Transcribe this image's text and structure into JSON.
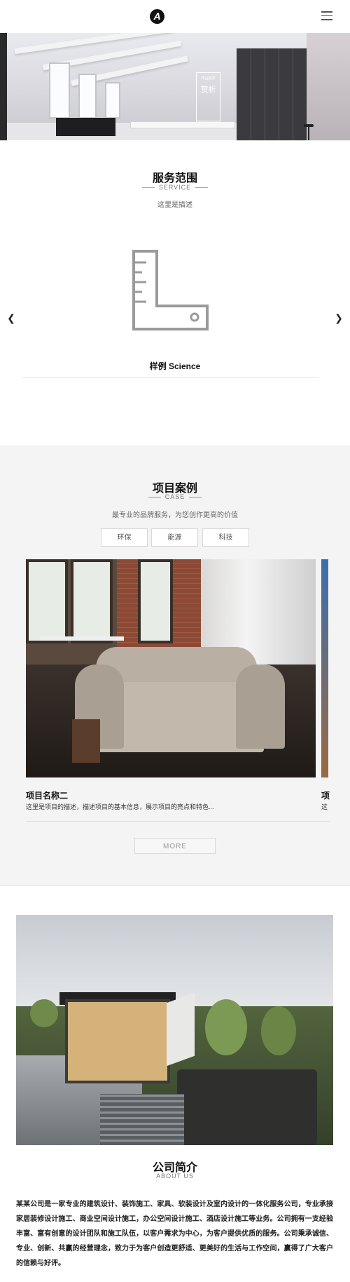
{
  "header": {
    "logo_letter": "A",
    "menu_icon": "hamburger-menu-icon"
  },
  "banner": {
    "sign_small": "作品鉴赏",
    "sign_big": "赏析"
  },
  "service": {
    "title": "服务范围",
    "subtitle": "SERVICE",
    "description": "这里是描述",
    "item_name": "样例 Science",
    "icon": "l-square-ruler-icon",
    "prev_icon": "chevron-left-icon",
    "next_icon": "chevron-right-icon"
  },
  "case": {
    "title": "项目案例",
    "subtitle": "CASE",
    "description": "最专业的品牌服务，为您创作更高的价值",
    "filters": [
      "环保",
      "能源",
      "科技"
    ],
    "item_name": "项目名称二",
    "item_text": "这里是项目的描述，描述项目的基本信息，展示项目的亮点和特色...",
    "next_item_name": "项",
    "next_item_text": "这",
    "more_label": "MORE"
  },
  "about": {
    "title": "公司简介",
    "subtitle": "ABOUT US",
    "text": "某某公司是一家专业的建筑设计、装饰施工、家具、软装设计及室内设计的一体化服务公司，专业承接家居装修设计施工、商业空间设计施工，办公空间设计施工、酒店设计施工等业务。公司拥有一支经验丰富、富有创意的设计团队和施工队伍，以客户需求为中心，为客户提供优质的服务。公司秉承诚信、专业、创新、共赢的经营理念，致力于为客户创造更舒适、更美好的生活与工作空间，赢得了广大客户的信赖与好评。"
  }
}
